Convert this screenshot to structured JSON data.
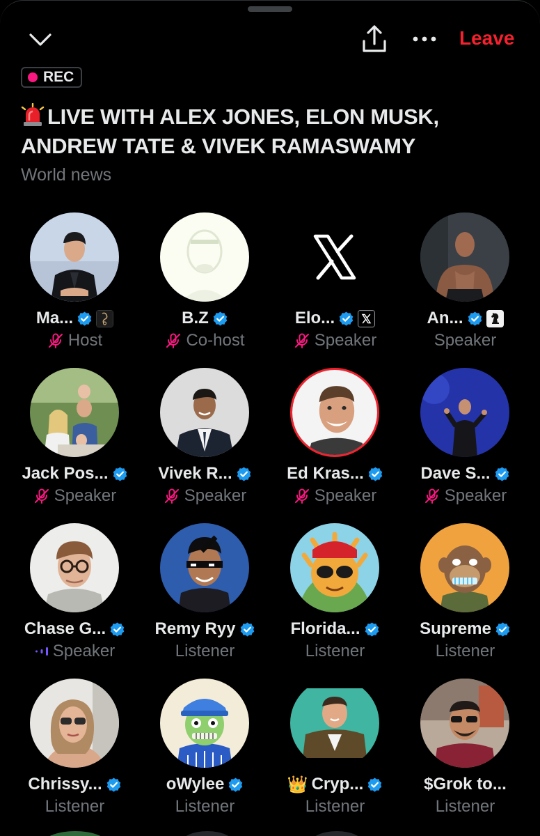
{
  "topbar": {
    "leave_label": "Leave"
  },
  "rec_label": "REC",
  "title_line1": "LIVE WITH ALEX JONES, ELON MUSK,",
  "title_line2": "ANDREW TATE & VIVEK RAMASWAMY",
  "subtitle": "World news",
  "colors": {
    "accent_red": "#f4212e",
    "verified_blue": "#1d9bf0",
    "muted": "#71767b",
    "rec_pink": "#f91880"
  },
  "participants": [
    {
      "name": "Ma...",
      "role": "Host",
      "muted": true,
      "affiliate": "sketch-badge-icon"
    },
    {
      "name": "B.Z",
      "role": "Co-host",
      "muted": true,
      "affiliate": ""
    },
    {
      "name": "Elo...",
      "role": "Speaker",
      "muted": true,
      "affiliate": "x-logo-icon"
    },
    {
      "name": "An...",
      "role": "Speaker",
      "muted": false,
      "affiliate": "chess-knight-icon"
    },
    {
      "name": "Jack Pos...",
      "role": "Speaker",
      "muted": true,
      "affiliate": ""
    },
    {
      "name": "Vivek R...",
      "role": "Speaker",
      "muted": true,
      "affiliate": ""
    },
    {
      "name": "Ed Kras...",
      "role": "Speaker",
      "muted": true,
      "affiliate": ""
    },
    {
      "name": "Dave S...",
      "role": "Speaker",
      "muted": true,
      "affiliate": ""
    },
    {
      "name": "Chase G...",
      "role": "Speaker",
      "muted": false,
      "speaking": true,
      "affiliate": ""
    },
    {
      "name": "Remy Ryy",
      "role": "Listener",
      "muted": false,
      "affiliate": ""
    },
    {
      "name": "Florida...",
      "role": "Listener",
      "muted": false,
      "affiliate": ""
    },
    {
      "name": "Supreme",
      "role": "Listener",
      "muted": false,
      "affiliate": ""
    },
    {
      "name": "Chrissy...",
      "role": "Listener",
      "muted": false,
      "affiliate": ""
    },
    {
      "name": "oWylee",
      "role": "Listener",
      "muted": false,
      "affiliate": ""
    },
    {
      "name": "Cryp...",
      "role": "Listener",
      "muted": false,
      "prefix": "👑",
      "affiliate": ""
    },
    {
      "name": "$Grok to...",
      "role": "Listener",
      "muted": false,
      "verified": false,
      "affiliate": ""
    }
  ]
}
